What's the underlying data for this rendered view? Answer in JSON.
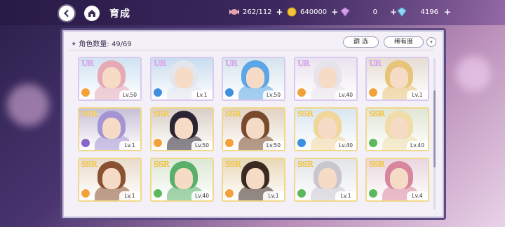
{
  "header": {
    "title": "育成",
    "resources": [
      {
        "icon": "candy-icon",
        "value": "262/112",
        "color": "#e8a0a8"
      },
      {
        "icon": "gold-coin-icon",
        "value": "640000",
        "color": "#f2c43a"
      },
      {
        "icon": "pink-gem-icon",
        "value": "0",
        "color": "#d69be8"
      },
      {
        "icon": "blue-gem-icon",
        "value": "4196",
        "color": "#8ed8f0"
      }
    ]
  },
  "panel": {
    "count_label": "角色数量: 49/69",
    "filter_label": "篩 选",
    "sort_label": "稀有度",
    "dropdown_symbol": "▾"
  },
  "cards": [
    {
      "rarity": "UR",
      "level": "Lv.50",
      "attr": "orange",
      "hair": "#e6a9b6",
      "bg": "#cfe3f2"
    },
    {
      "rarity": "UR",
      "level": "Lv.1",
      "attr": "blue",
      "hair": "#e4e6ee",
      "bg": "#c9dcef"
    },
    {
      "rarity": "UR",
      "level": "Lv.50",
      "attr": "blue",
      "hair": "#5aa6e6",
      "bg": "#d6e4ee"
    },
    {
      "rarity": "UR",
      "level": "Lv.40",
      "attr": "orange",
      "hair": "#e6e4ea",
      "bg": "#ebe3ee"
    },
    {
      "rarity": "UR",
      "level": "Lv.1",
      "attr": "orange",
      "hair": "#e8c47a",
      "bg": "#e6ddd3"
    },
    {
      "rarity": "SSR",
      "level": "Lv.1",
      "attr": "purple",
      "hair": "#a594d4",
      "bg": "#c8c0d6"
    },
    {
      "rarity": "SSR",
      "level": "Lv.50",
      "attr": "orange",
      "hair": "#2b2433",
      "bg": "#d8cfc6"
    },
    {
      "rarity": "SSR",
      "level": "Lv.50",
      "attr": "orange",
      "hair": "#7a4a2e",
      "bg": "#e2d2c0"
    },
    {
      "rarity": "SSR",
      "level": "Lv.40",
      "attr": "blue",
      "hair": "#f0d69a",
      "bg": "#d9e6f0"
    },
    {
      "rarity": "SSR",
      "level": "Lv.40",
      "attr": "green",
      "hair": "#efdca8",
      "bg": "#e0e6d4"
    },
    {
      "rarity": "SSR",
      "level": "Lv.1",
      "attr": "orange",
      "hair": "#8a5232",
      "bg": "#e9dccb"
    },
    {
      "rarity": "SSR",
      "level": "Lv.40",
      "attr": "green",
      "hair": "#5ab06a",
      "bg": "#dde8d6"
    },
    {
      "rarity": "SSR",
      "level": "Lv.1",
      "attr": "orange",
      "hair": "#3a2a22",
      "bg": "#e8d8b8"
    },
    {
      "rarity": "SSR",
      "level": "Lv.1",
      "attr": "green",
      "hair": "#c9c6cf",
      "bg": "#e2e4e8"
    },
    {
      "rarity": "SSR",
      "level": "Lv.4",
      "attr": "green",
      "hair": "#d8869e",
      "bg": "#ead6de"
    }
  ],
  "attr_colors": {
    "orange": "#f3a13a",
    "blue": "#3f8fe0",
    "purple": "#8a66c9",
    "green": "#5cb85c"
  }
}
